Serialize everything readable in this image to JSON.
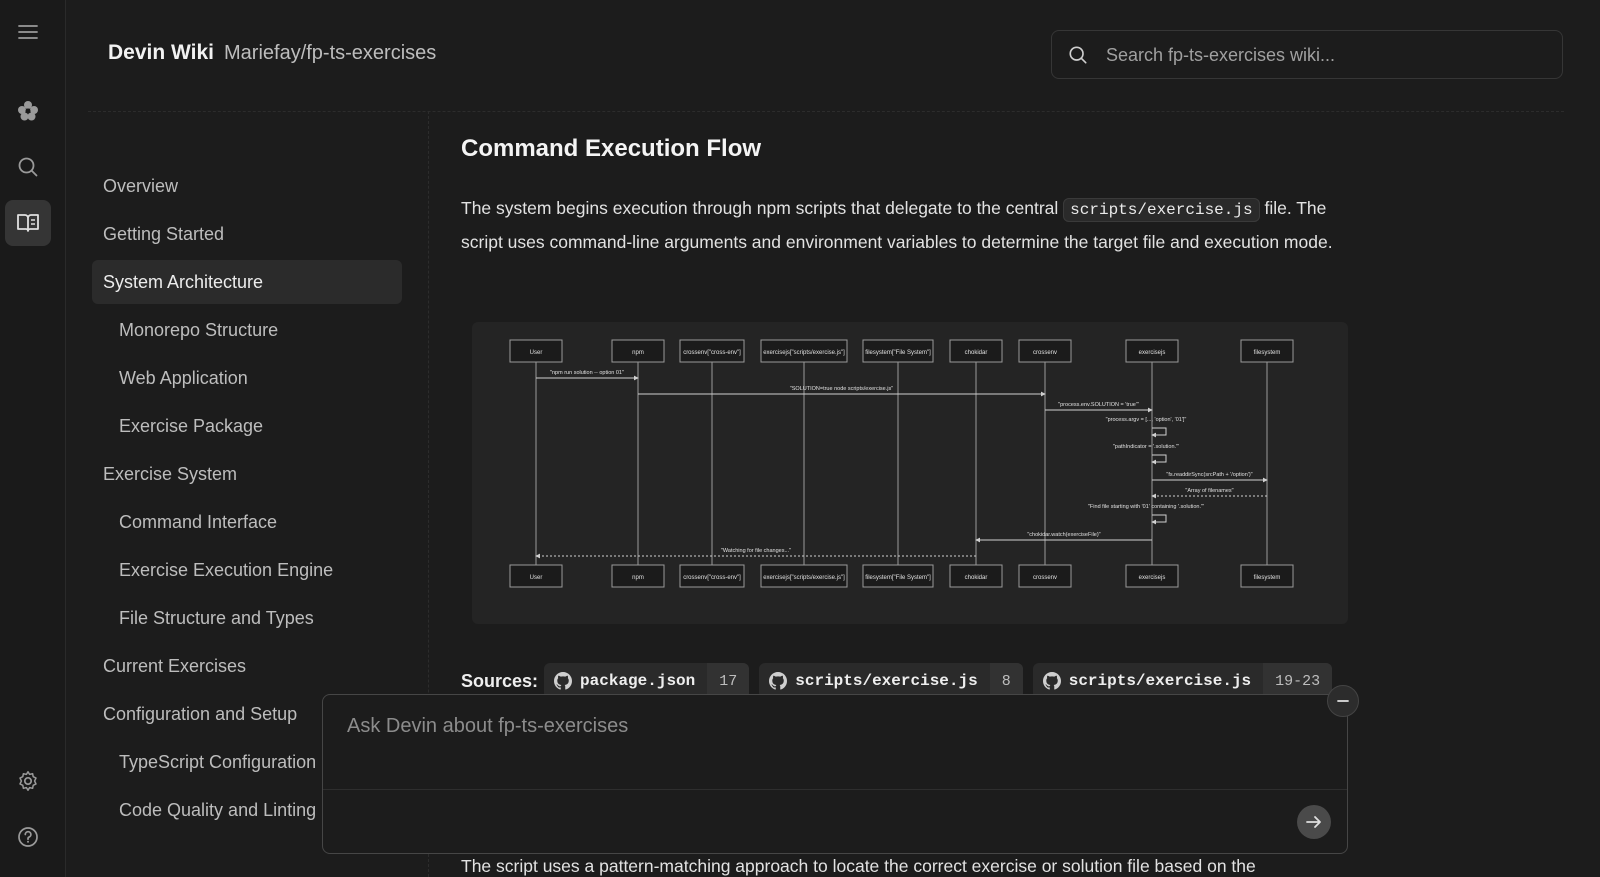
{
  "header": {
    "brand": "Devin Wiki",
    "repo": "Mariefay/fp-ts-exercises",
    "search_placeholder": "Search fp-ts-exercises wiki..."
  },
  "rail": {
    "icons": [
      "menu-icon",
      "flower-icon",
      "search-icon",
      "book-icon",
      "gear-icon",
      "help-icon"
    ]
  },
  "sidebar": {
    "items": [
      {
        "label": "Overview",
        "level": 0
      },
      {
        "label": "Getting Started",
        "level": 0
      },
      {
        "label": "System Architecture",
        "level": 0,
        "active": true
      },
      {
        "label": "Monorepo Structure",
        "level": 1
      },
      {
        "label": "Web Application",
        "level": 1
      },
      {
        "label": "Exercise Package",
        "level": 1
      },
      {
        "label": "Exercise System",
        "level": 0
      },
      {
        "label": "Command Interface",
        "level": 1
      },
      {
        "label": "Exercise Execution Engine",
        "level": 1
      },
      {
        "label": "File Structure and Types",
        "level": 1
      },
      {
        "label": "Current Exercises",
        "level": 0
      },
      {
        "label": "Configuration and Setup",
        "level": 0
      },
      {
        "label": "TypeScript Configuration",
        "level": 1
      },
      {
        "label": "Code Quality and Linting",
        "level": 1
      }
    ]
  },
  "main": {
    "heading": "Command Execution Flow",
    "para_before": "The system begins execution through npm scripts that delegate to the central ",
    "para_code": "scripts/exercise.js",
    "para_after": " file. The script uses command-line arguments and environment variables to determine the target file and execution mode.",
    "bottom_text": "The script uses a pattern-matching approach to locate the correct exercise or solution file based on the"
  },
  "diagram": {
    "participants": [
      "User",
      "npm",
      "crossenv[\"cross-env\"]",
      "exercisejs[\"scripts/exercise.js\"]",
      "filesystem[\"File System\"]",
      "chokidar",
      "crossenv",
      "exercisejs",
      "filesystem"
    ],
    "messages": [
      "\"npm run solution -- option 01\"",
      "\"SOLUTION=true node scripts/exercise.js\"",
      "\"process.env.SOLUTION = 'true'\"",
      "\"process.argv = [..., 'option', '01']\"",
      "\"pathIndicator = '.solution.'\"",
      "\"fs.readdirSync(srcPath + '/option')\"",
      "\"Array of filenames\"",
      "\"Find file starting with '01' containing '.solution.'\"",
      "\"chokidar.watch(exerciseFile)\"",
      "\"Watching for file changes...\""
    ]
  },
  "sources": {
    "label": "Sources:",
    "chips": [
      {
        "file": "package.json",
        "lines": "17"
      },
      {
        "file": "scripts/exercise.js",
        "lines": "8"
      },
      {
        "file": "scripts/exercise.js",
        "lines": "19-23"
      }
    ]
  },
  "ask": {
    "placeholder": "Ask Devin about fp-ts-exercises"
  }
}
